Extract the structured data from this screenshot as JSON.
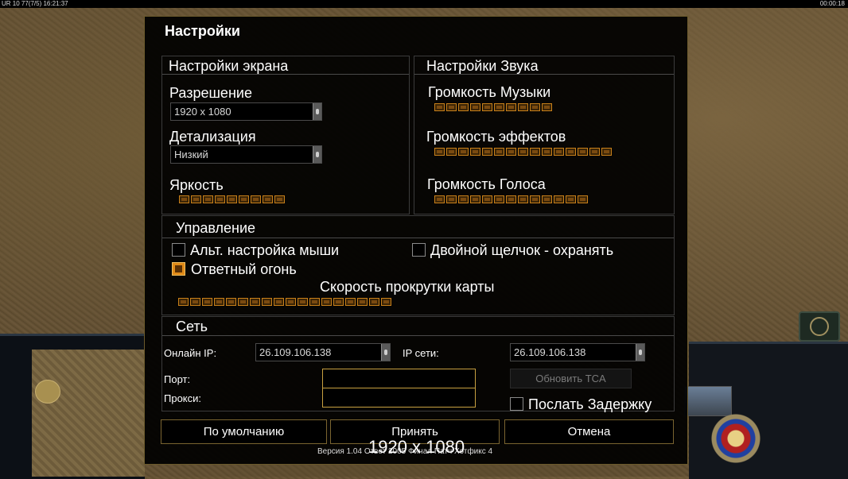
{
  "hud": {
    "top_left": "UR 10 77(7/5) 16:21:37",
    "top_right": "00:00:18"
  },
  "dialog": {
    "title": "Настройки",
    "screen": {
      "header": "Настройки экрана",
      "resolution_label": "Разрешение",
      "resolution_value": "1920 x 1080",
      "detail_label": "Детализация",
      "detail_value": "Низкий",
      "brightness_label": "Яркость",
      "brightness_segments": 9
    },
    "sound": {
      "header": "Настройки Звука",
      "music_label": "Громкость Музыки",
      "music_segments": 10,
      "effects_label": "Громкость эффектов",
      "effects_segments": 15,
      "voice_label": "Громкость Голоса",
      "voice_segments": 13
    },
    "control": {
      "header": "Управление",
      "alt_mouse_label": "Альт. настройка мыши",
      "alt_mouse_checked": false,
      "double_click_label": "Двойной щелчок - охранять",
      "double_click_checked": false,
      "return_fire_label": "Ответный огонь",
      "return_fire_checked": true,
      "scroll_speed_label": "Скорость прокрутки карты",
      "scroll_speed_segments": 18
    },
    "network": {
      "header": "Сеть",
      "online_ip_label": "Онлайн IP:",
      "online_ip_value": "26.109.106.138",
      "lan_ip_label": "IP сети:",
      "lan_ip_value": "26.109.106.138",
      "port_label": "Порт:",
      "port_value": "",
      "proxy_label": "Прокси:",
      "proxy_value": "",
      "update_tca_label": "Обновить TCA",
      "send_delay_label": "Послать Задержку",
      "send_delay_checked": false
    },
    "buttons": {
      "default": "По умолчанию",
      "accept": "Принять",
      "cancel": "Отмена"
    },
    "version": "Версия 1.04 Ответ 2005 Финал Патч Хотфикс 4",
    "overlay_resolution": "1920 x 1080"
  },
  "colors": {
    "accent": "#c8801a",
    "border": "#6b5a2c"
  }
}
